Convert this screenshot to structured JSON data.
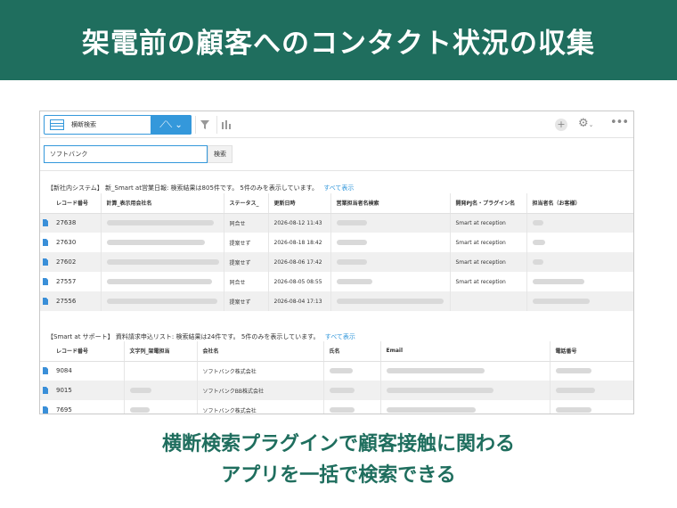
{
  "banner": {
    "title": "架電前の顧客へのコンタクト状況の収集"
  },
  "toolbar": {
    "view_label": "横断検索"
  },
  "search": {
    "value": "ソフトバンク",
    "button_label": "検索"
  },
  "section1": {
    "title": "【新社内システム】 新_Smart at営業日報: 検索結果は805件です。 5件のみを表示しています。",
    "show_all": "すべて表示",
    "columns": [
      "レコード番号",
      "計算_表示用会社名",
      "ステータス_",
      "更新日時",
      "営業担当者名検索",
      "開発PJ名・プラグイン名",
      "担当者名（お客様）"
    ],
    "rows": [
      {
        "id": "27638",
        "status": "同合せ",
        "updated": "2026-08-12 11:43",
        "plugin": "Smart at reception"
      },
      {
        "id": "27630",
        "status": "提案せず",
        "updated": "2026-08-18 18:42",
        "plugin": "Smart at reception"
      },
      {
        "id": "27602",
        "status": "提案せず",
        "updated": "2026-08-06 17:42",
        "plugin": "Smart at reception"
      },
      {
        "id": "27557",
        "status": "同合せ",
        "updated": "2026-08-05 08:55",
        "plugin": "Smart at reception"
      },
      {
        "id": "27556",
        "status": "提案せず",
        "updated": "2026-08-04 17:13",
        "plugin": ""
      }
    ]
  },
  "section2": {
    "title": "【Smart at サポート】 資料請求申込リスト: 検索結果は24件です。 5件のみを表示しています。",
    "show_all": "すべて表示",
    "columns": [
      "レコード番号",
      "文字列_架電担当",
      "会社名",
      "氏名",
      "Email",
      "電話番号"
    ],
    "rows": [
      {
        "id": "9084",
        "company": "ソフトバンク株式会社"
      },
      {
        "id": "9015",
        "company": "ソフトバンクBB株式会社"
      },
      {
        "id": "7695",
        "company": "ソフトバンク株式会社"
      }
    ]
  },
  "caption": {
    "line1": "横断検索プラグインで顧客接触に関わる",
    "line2": "アプリを一括で検索できる"
  },
  "colors": {
    "brand": "#1f6e5e",
    "accent": "#3498db"
  },
  "icons": [
    "grid-icon",
    "chevron-down-icon",
    "graph-icon",
    "filter-icon",
    "bar-chart-icon",
    "plus-icon",
    "gear-icon",
    "more-icon",
    "document-icon"
  ]
}
